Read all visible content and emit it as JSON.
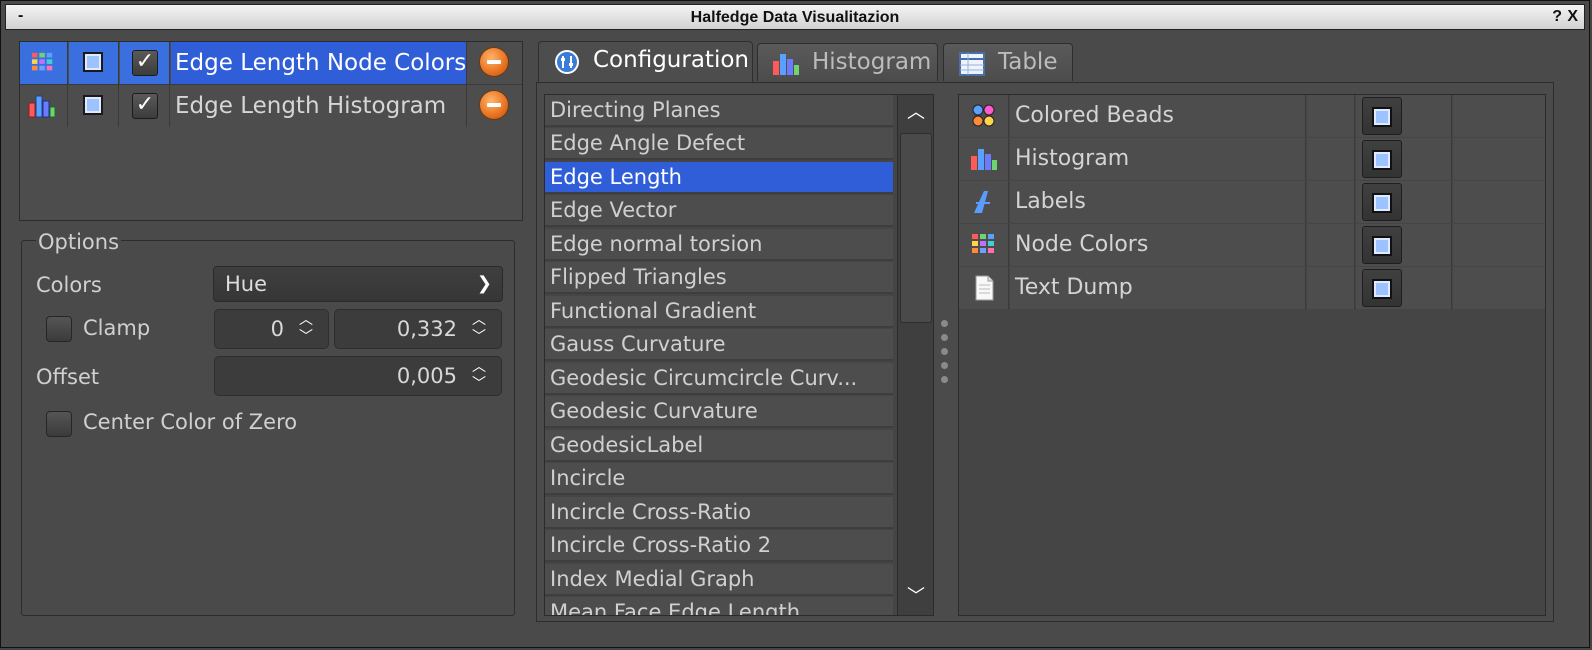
{
  "window": {
    "title": "Halfedge Data Visualitazion",
    "menu_label": "-",
    "help_label": "?",
    "close_label": "X"
  },
  "layers": [
    {
      "name": "Edge Length Node Colors",
      "icon": "node-colors-icon",
      "visible": true,
      "checked": true,
      "selected": true
    },
    {
      "name": "Edge Length Histogram",
      "icon": "histogram-icon",
      "visible": true,
      "checked": true,
      "selected": false
    }
  ],
  "options": {
    "title": "Options",
    "colors_label": "Colors",
    "colors_value": "Hue",
    "clamp_label": "Clamp",
    "clamp_min": "0",
    "clamp_max": "0,332",
    "offset_label": "Offset",
    "offset_value": "0,005",
    "center_label": "Center Color of Zero"
  },
  "tabs": [
    {
      "label": "Configuration",
      "icon": "configuration-icon",
      "active": true
    },
    {
      "label": "Histogram",
      "icon": "histogram-icon",
      "active": false
    },
    {
      "label": "Table",
      "icon": "table-icon",
      "active": false
    }
  ],
  "adapters": [
    "Directing Planes",
    "Edge Angle Defect",
    "Edge Length",
    "Edge Vector",
    "Edge normal torsion",
    "Flipped Triangles",
    "Functional Gradient",
    "Gauss Curvature",
    "Geodesic Circumcircle Curv...",
    "Geodesic Curvature",
    "GeodesicLabel",
    "Incircle",
    "Incircle Cross-Ratio",
    "Incircle Cross-Ratio 2",
    "Index Medial Graph",
    "Mean Face Edge Length"
  ],
  "selected_adapter": "Edge Length",
  "visualizers": [
    {
      "name": "Colored Beads",
      "icon": "colored-beads-icon"
    },
    {
      "name": "Histogram",
      "icon": "histogram-icon"
    },
    {
      "name": "Labels",
      "icon": "labels-icon"
    },
    {
      "name": "Node Colors",
      "icon": "node-colors-icon"
    },
    {
      "name": "Text Dump",
      "icon": "text-dump-icon"
    }
  ],
  "colors": {
    "selection": "#2f5ed8",
    "remove_button": "#e8711f",
    "toggle_fill": "#9cc3ff"
  }
}
